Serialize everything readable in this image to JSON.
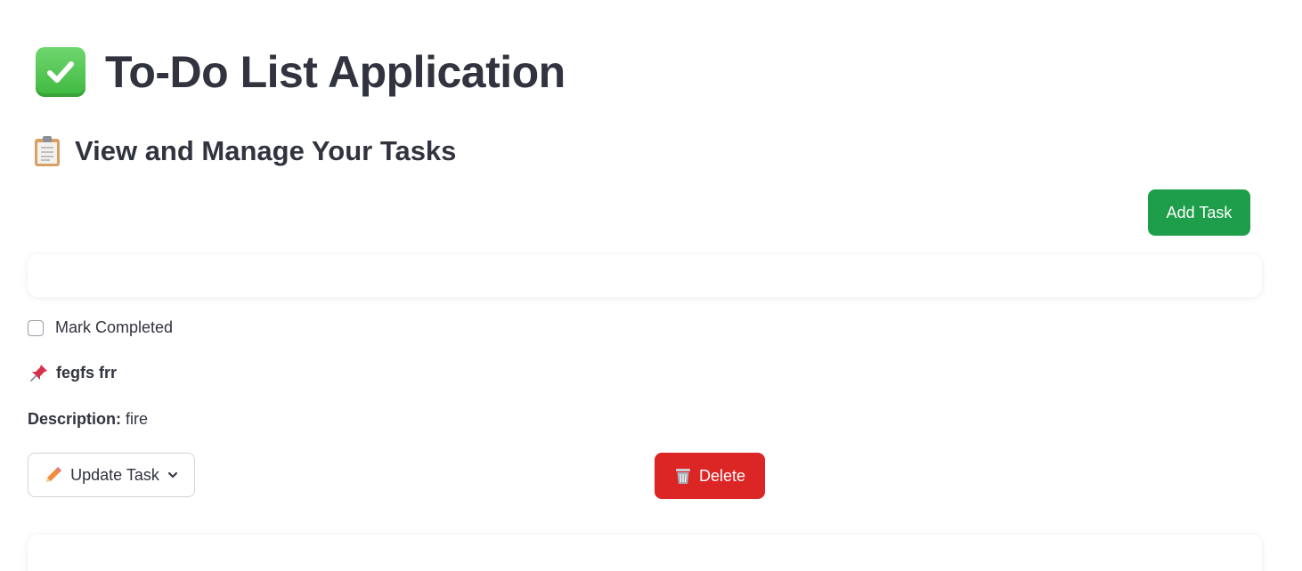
{
  "app": {
    "title": "To-Do List Application",
    "title_icon": "check-mark-button-icon"
  },
  "section": {
    "subtitle": "View and Manage Your Tasks",
    "subtitle_icon": "clipboard-icon"
  },
  "toolbar": {
    "add_task_label": "Add Task"
  },
  "task": {
    "mark_completed_label": "Mark Completed",
    "completed": false,
    "title_icon": "pushpin-icon",
    "title": "fegfs frr",
    "description_label": "Description:",
    "description_value": "fire",
    "update_label": "Update Task",
    "update_icon": "pencil-icon",
    "delete_label": "Delete",
    "delete_icon": "wastebasket-icon"
  },
  "colors": {
    "primary_green": "#1e9e4a",
    "danger_red": "#dc2626",
    "text": "#31333f"
  }
}
